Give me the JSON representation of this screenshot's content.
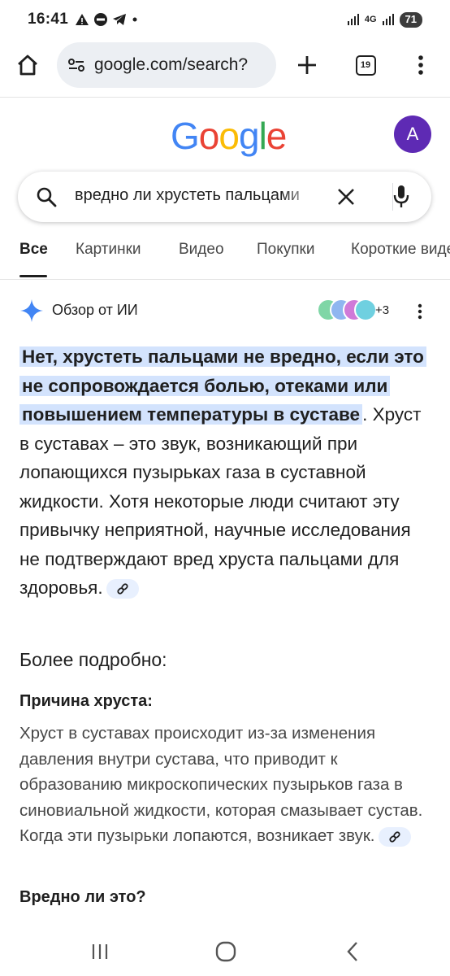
{
  "status_bar": {
    "time": "16:41",
    "network": "4G",
    "battery": "71"
  },
  "browser": {
    "url": "google.com/search?",
    "tab_count": "19"
  },
  "google": {
    "logo_letters": [
      "G",
      "o",
      "o",
      "g",
      "l",
      "e"
    ],
    "logo_colors": [
      "#4285f4",
      "#ea4335",
      "#fbbc05",
      "#4285f4",
      "#34a853",
      "#ea4335"
    ],
    "avatar_letter": "A",
    "avatar_color": "#5e2ab4"
  },
  "search": {
    "query": "вредно ли хрустеть пальцами"
  },
  "tabs": [
    {
      "label": "Все",
      "active": true
    },
    {
      "label": "Картинки"
    },
    {
      "label": "Видео"
    },
    {
      "label": "Покупки"
    },
    {
      "label": "Короткие видео"
    }
  ],
  "ai_overview": {
    "title": "Обзор от ИИ",
    "more_sources": "+3",
    "highlight": "Нет, хрустеть пальцами не вредно, если это не сопровождается болью, отеками или повышением температуры в суставе",
    "body": ". Хруст в суставах – это звук, возникающий при лопающихся пузырьках газа в суставной жидкости. Хотя некоторые люди считают эту привычку неприятной, научные исследования не подтверждают вред хруста пальцами для здоровья.",
    "more_title": "Более подробно:",
    "section1_title": "Причина хруста:",
    "section1_text": "Хруст в суставах происходит из-за изменения давления внутри сустава, что приводит к образованию микроскопических пузырьков газа в синовиальной жидкости, которая смазывает сустав. Когда эти пузырьки лопаются, возникает звук.",
    "section2_title": "Вредно ли это?"
  },
  "colors": {
    "highlight_bg": "#d3e3fd",
    "accent_blue": "#1a73e8"
  }
}
